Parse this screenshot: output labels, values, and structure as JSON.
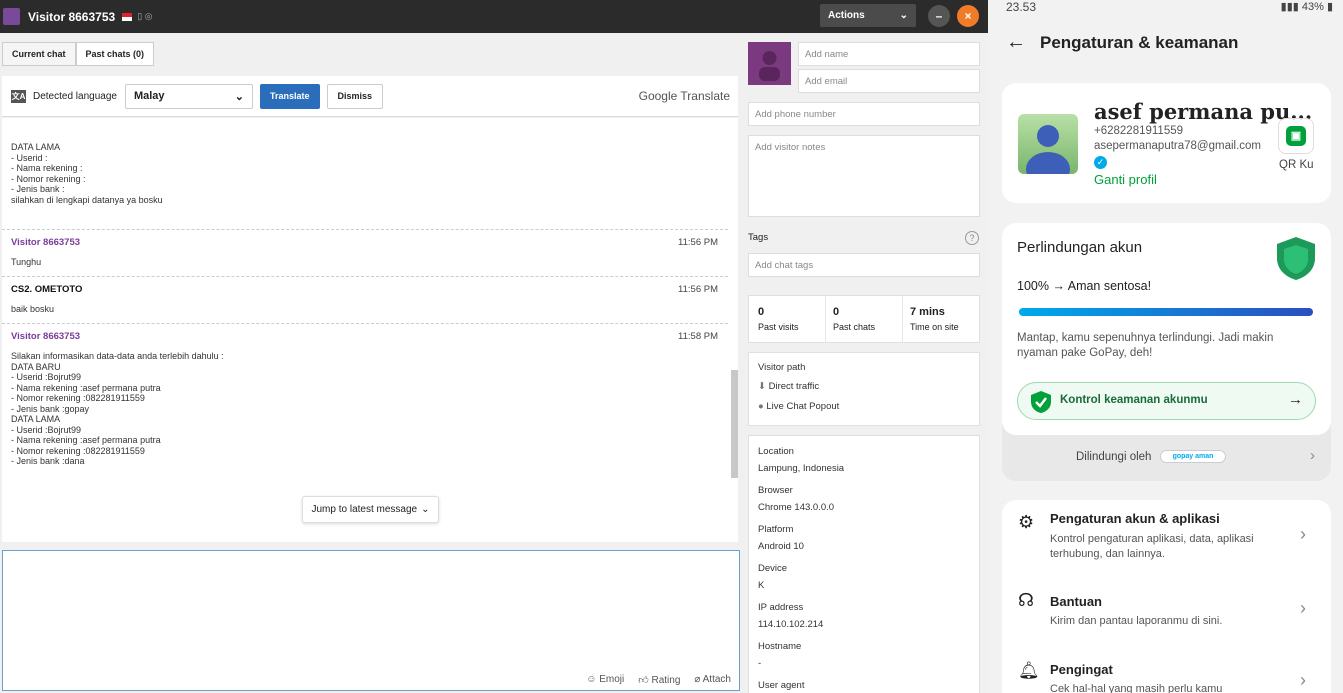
{
  "window": {
    "title": "Visitor 8663753",
    "actions_label": "Actions"
  },
  "tabs": [
    "Current chat",
    "Past chats (0)"
  ],
  "translate": {
    "detected_label": "Detected language",
    "language": "Malay",
    "translate_btn": "Translate",
    "dismiss_btn": "Dismiss",
    "provider": "Google Translate"
  },
  "messages": {
    "block0": [
      "DATA LAMA",
      "- Userid :",
      "- Nama rekening :",
      "- Nomor rekening :",
      "- Jenis bank :",
      "silahkan di lengkapi datanya ya bosku"
    ],
    "m1": {
      "sender": "Visitor 8663753",
      "time": "11:56 PM",
      "text": "Tunghu"
    },
    "m2": {
      "sender": "CS2. OMETOTO",
      "time": "11:56 PM",
      "text": "baik bosku"
    },
    "m3": {
      "sender": "Visitor 8663753",
      "time": "11:58 PM",
      "lines": [
        "Silakan informasikan data-data anda terlebih dahulu :",
        "",
        "DATA BARU",
        "- Userid :Bojrut99",
        "- Nama rekening :asef permana putra",
        "- Nomor rekening :082281911559",
        "- Jenis bank :gopay",
        "",
        "",
        "DATA LAMA",
        "- Userid :Bojrut99",
        "- Nama rekening :asef permana putra",
        "- Nomor rekening :082281911559",
        "- Jenis bank :dana"
      ]
    }
  },
  "jump_label": "Jump to latest message",
  "composer": {
    "emoji": "Emoji",
    "rating": "Rating",
    "attach": "Attach"
  },
  "visitor": {
    "add_name": "Add name",
    "add_email": "Add email",
    "add_phone": "Add phone number",
    "add_notes": "Add visitor notes",
    "tags_label": "Tags",
    "add_tags": "Add chat tags",
    "past_visits": "0",
    "past_visits_label": "Past visits",
    "past_chats": "0",
    "past_chats_label": "Past chats",
    "time_on_site": "7 mins",
    "time_on_site_label": "Time on site",
    "visitor_path_label": "Visitor path",
    "path1": "Direct traffic",
    "path2": "Live Chat Popout",
    "location_label": "Location",
    "location": "Lampung, Indonesia",
    "browser_label": "Browser",
    "browser": "Chrome 143.0.0.0",
    "platform_label": "Platform",
    "platform": "Android 10",
    "device_label": "Device",
    "device": "K",
    "ip_label": "IP address",
    "ip": "114.10.102.214",
    "hostname_label": "Hostname",
    "hostname": "-",
    "ua_label": "User agent"
  },
  "phone": {
    "time": "23.53",
    "battery": "43%",
    "title": "Pengaturan & keamanan",
    "name": "asef permana pu...",
    "number": "+6282281911559",
    "email": "asepermanaputra78@gmail.com",
    "edit_profile": "Ganti profil",
    "qr_label": "QR Ku",
    "protect_title": "Perlindungan akun",
    "protect_status": "100% → Aman sentosa!",
    "progress": 1.0,
    "protect_desc": "Mantap, kamu sepenuhnya terlindungi. Jadi makin nyaman pake GoPay, deh!",
    "control_btn": "Kontrol keamanan akunmu",
    "protected_by": "Dilindungi oleh",
    "settings_title": "Pengaturan akun & aplikasi",
    "settings_desc": "Kontrol pengaturan aplikasi, data, aplikasi terhubung, dan lainnya.",
    "help_title": "Bantuan",
    "help_desc": "Kirim dan pantau laporanmu di sini.",
    "reminder_title": "Pengingat",
    "reminder_desc": "Cek hal-hal yang masih perlu kamu"
  }
}
